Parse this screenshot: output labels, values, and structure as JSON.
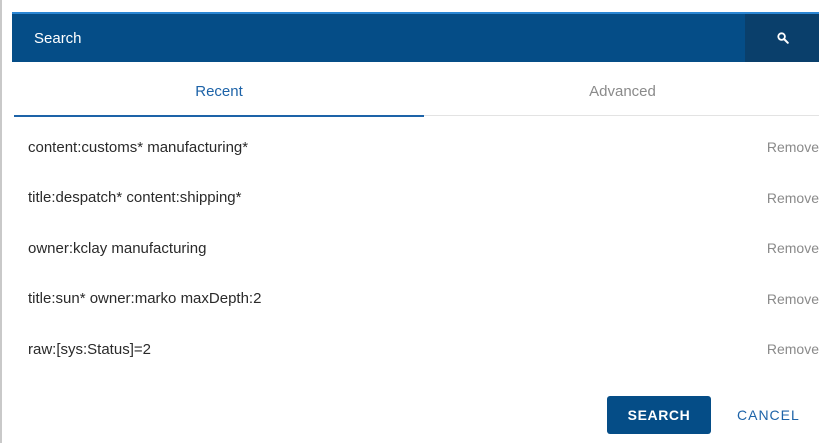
{
  "search": {
    "placeholder": "Search",
    "button_icon": "search-icon"
  },
  "tabs": [
    {
      "label": "Recent",
      "active": true
    },
    {
      "label": "Advanced",
      "active": false
    }
  ],
  "recent": [
    {
      "query": "content:customs* manufacturing*",
      "remove_label": "Remove"
    },
    {
      "query": "title:despatch* content:shipping*",
      "remove_label": "Remove"
    },
    {
      "query": "owner:kclay manufacturing",
      "remove_label": "Remove"
    },
    {
      "query": "title:sun* owner:marko maxDepth:2",
      "remove_label": "Remove"
    },
    {
      "query": "raw:[sys:Status]=2",
      "remove_label": "Remove"
    }
  ],
  "footer": {
    "search_label": "SEARCH",
    "cancel_label": "CANCEL"
  },
  "colors": {
    "header_bg": "#054d87",
    "accent": "#1d63a8",
    "muted": "#8a8a8a"
  }
}
